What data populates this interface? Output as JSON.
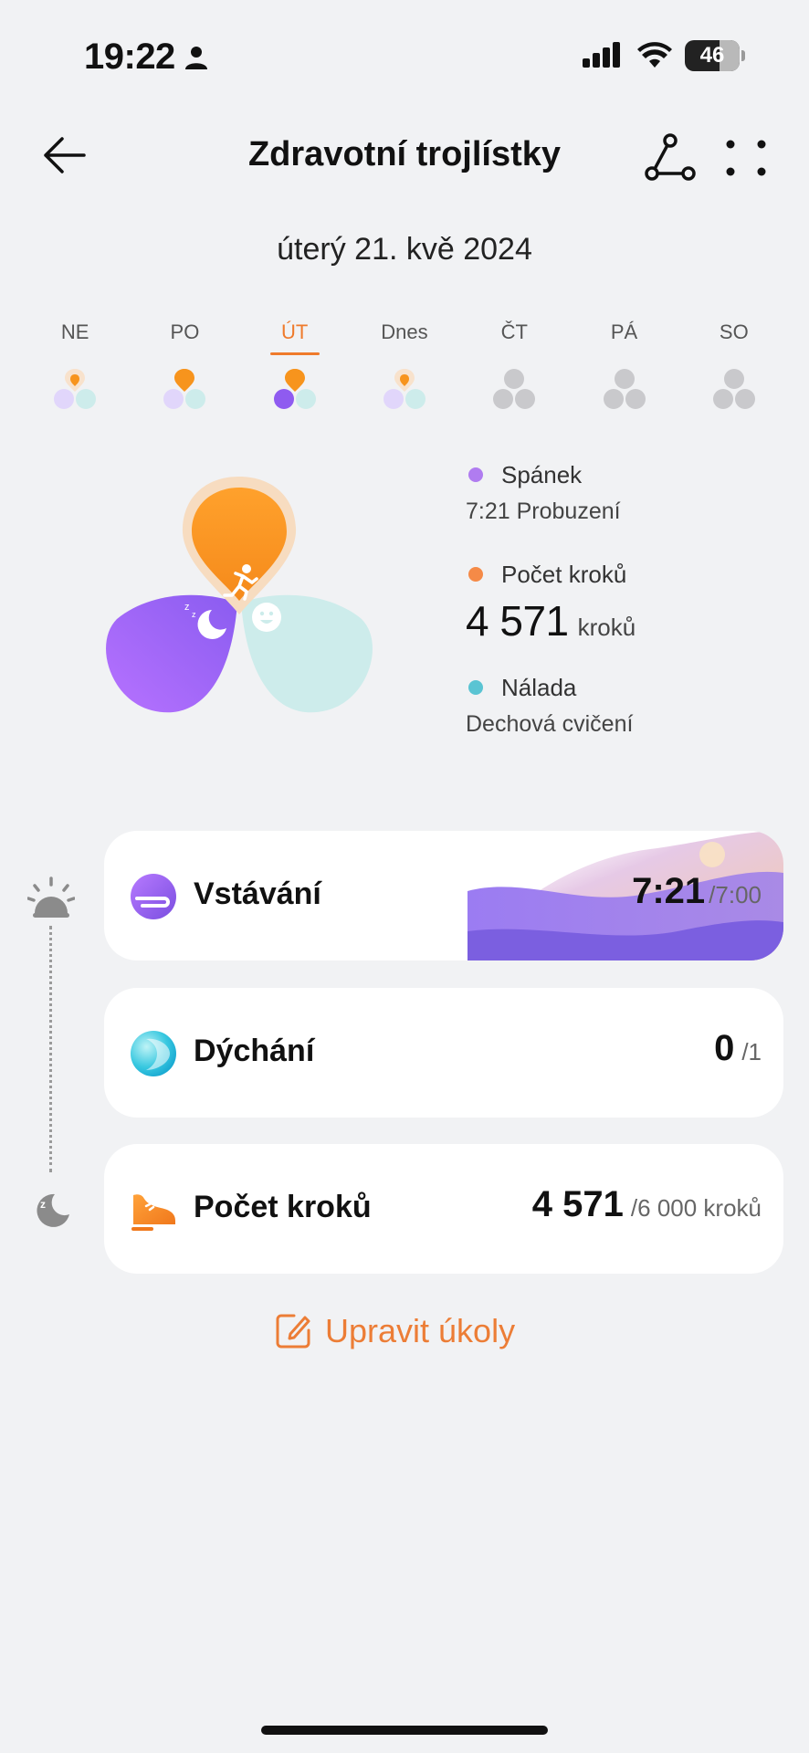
{
  "status_bar": {
    "time": "19:22",
    "battery": "46"
  },
  "header": {
    "title": "Zdravotní trojlístky"
  },
  "date": "úterý 21. kvě 2024",
  "week": {
    "days": [
      {
        "label": "NE",
        "state": "past"
      },
      {
        "label": "PO",
        "state": "past"
      },
      {
        "label": "ÚT",
        "state": "selected"
      },
      {
        "label": "Dnes",
        "state": "today"
      },
      {
        "label": "ČT",
        "state": "future"
      },
      {
        "label": "PÁ",
        "state": "future"
      },
      {
        "label": "SO",
        "state": "future"
      }
    ]
  },
  "legend": {
    "sleep": {
      "label": "Spánek",
      "value": "7:21 Probuzení",
      "color": "#b07cf0"
    },
    "steps": {
      "label": "Počet kroků",
      "value": "4 571",
      "unit": "kroků",
      "color": "#f58a47"
    },
    "mood": {
      "label": "Nálada",
      "value": "Dechová cvičení",
      "color": "#5ac4d3"
    }
  },
  "tasks": [
    {
      "name": "Vstávání",
      "value": "7:21",
      "goal": "/7:00",
      "icon": "wake-up-icon"
    },
    {
      "name": "Dýchání",
      "value": "0",
      "goal": "/1",
      "icon": "breathing-icon"
    },
    {
      "name": "Počet kroků",
      "value": "4 571",
      "goal": "/6 000 kroků",
      "icon": "sneaker-icon"
    }
  ],
  "edit_button": {
    "label": "Upravit úkoly"
  },
  "colors": {
    "accent": "#ef7a2b",
    "sleep": "#a56cf0",
    "steps": "#f7941d",
    "mood": "#cdeceb",
    "background": "#f1f2f4"
  }
}
